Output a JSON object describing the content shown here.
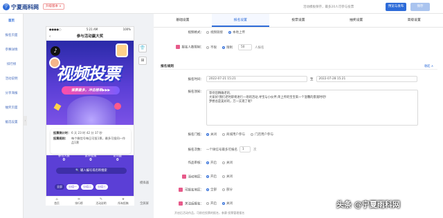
{
  "header": {
    "logo_mark": "宁",
    "logo_text": "宁夏雨科网",
    "upgrade_label": "升级版本 ∧",
    "tip": "活动模板保存，最多20人可参与投票",
    "preview_label": "预览与发布",
    "save_label": "保存"
  },
  "sidebar": {
    "items": [
      {
        "label": "首页"
      },
      {
        "label": "报名页面"
      },
      {
        "label": "参赛详情"
      },
      {
        "label": "排行榜"
      },
      {
        "label": "活动说明"
      },
      {
        "label": "分享海报"
      },
      {
        "label": "抽奖页面"
      },
      {
        "label": "截选设置"
      }
    ],
    "collapse": "‹"
  },
  "phone": {
    "status_left": "●●●●○",
    "status_time": "5:21 AM",
    "status_right": "100%",
    "back": "‹",
    "title": "参与活动赢大奖",
    "banner_title": "视频投票",
    "banner_sub": "谁票最多，冲击榜单▶▶▶",
    "countdown_label": "投票倒计时：",
    "countdown_value": "6 天 23 时 42 分 37 秒",
    "rule_label": "投票规则：",
    "rule_value": "每个微信号每日可投1票，最多可投同一作品1票",
    "stats": [
      {
        "label": "参与人数",
        "value": "0"
      },
      {
        "label": "累计投票",
        "value": "0"
      },
      {
        "label": "访问量",
        "value": "0"
      }
    ],
    "search_placeholder": "🔍 输入编号或名称搜索",
    "groups": [
      "全部",
      "分组一",
      "分组二",
      "分组三"
    ],
    "tabbar": [
      {
        "icon": "⌂",
        "label": "首页"
      },
      {
        "icon": "≡",
        "label": "排行榜"
      },
      {
        "icon": "✎",
        "label": "活动说明"
      },
      {
        "icon": "★",
        "label": "所有投稿"
      }
    ]
  },
  "tools": {
    "shirt_icon": "👕",
    "grid_icon": "⊞",
    "label1": "模拟器",
    "label2": "全屏屏"
  },
  "tabs": [
    "基础设置",
    "报名设置",
    "投票设置",
    "抽奖设置",
    "高级设置"
  ],
  "form": {
    "video_mode": {
      "label": "视频格式：",
      "opt1": "视频链接",
      "opt2": "本地上传"
    },
    "limit": {
      "label": "报名人数限制：",
      "opt1": "不限",
      "opt2": "限制",
      "value": "50",
      "unit": "人报名"
    },
    "section_title": "报名规则",
    "collapse_label": "收起 ∧",
    "time": {
      "label": "报名时间：",
      "start": "2022-07-21 15:21",
      "sep": "至",
      "end": "2022-07-28 15:21"
    },
    "desc": {
      "label": "报名须知：",
      "lines": [
        "等待您精确老的,",
        "大家好!我们老时即将进行一场的活动,寻宝与小伙伴,单上传的宝宝来一个温馨的景观时吧!",
        "梦想总是美好的，万一实现了呢？"
      ]
    },
    "threshold": {
      "label": "报名门槛：",
      "opt1": "关闭",
      "opt2": "商城用户参与",
      "opt3": "门店用户参与"
    },
    "count": {
      "label": "报名次数：",
      "prefix": "一个微信号最多可报名",
      "value": "1",
      "unit": "次"
    },
    "review": {
      "label": "作品审核：",
      "opt1": "开启",
      "opt2": "关闭"
    },
    "region": {
      "label": "活动地区：",
      "opt1": "开启",
      "opt2": "关闭"
    },
    "area": {
      "label": "可报名地区：",
      "opt1": "全部",
      "opt2": "部分"
    },
    "follow": {
      "label": "关注后报名：",
      "opt1": "开启",
      "opt2": "关闭"
    },
    "footer_hint": "开启后活动作品，可前往投票的报名，参赛·投票管理报名"
  },
  "watermark": "头条 @宁夏雨科网",
  "colors": {
    "accent": "#2d6bd8",
    "banner": "#5b3fd6",
    "label_icon": "#e75a8a"
  }
}
